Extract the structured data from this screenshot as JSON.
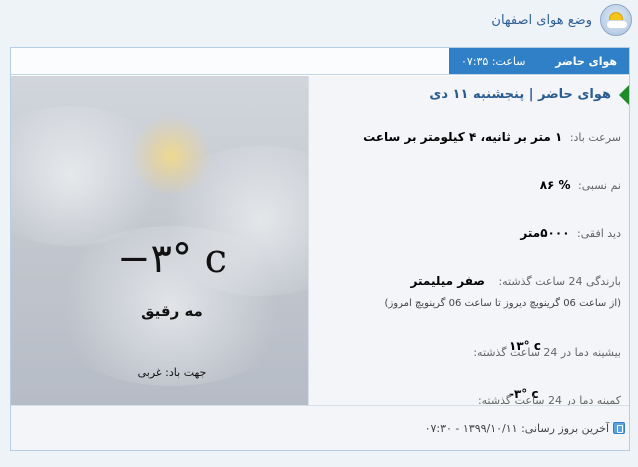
{
  "header": {
    "site_title": "وضع هوای اصفهان",
    "logo_icon": "sun-cloud-icon"
  },
  "tab": {
    "label": "هوای حاضر",
    "time": "ساعت: ۰۷:۳۵"
  },
  "details": {
    "title": "هوای حاضر | پنجشنبه ۱۱ دی",
    "wind_label": "سرعت باد:",
    "wind_value": "۱ متر بر ثانیه، ۴ کیلومتر بر ساعت",
    "humidity_label": "نم نسبی:",
    "humidity_value": "% ۸۶",
    "visibility_label": "دید افقی:",
    "visibility_value": "۵۰۰۰متر",
    "rain_label": "بارندگی 24 ساعت گذشته:",
    "rain_value": "صفر میلیمتر",
    "rain_note": "(از ساعت 06 گرینویچ دیروز تا ساعت 06 گرینویچ امروز)",
    "max_label": "بیشینه دما در 24 ساعت گذشته:",
    "max_value": "۱۳° c",
    "min_label": "کمینه دما در 24 ساعت گذشته:",
    "min_value": "-۳° c"
  },
  "current": {
    "temperature": "−۳° c",
    "condition": "مه رقیق",
    "wind_direction": "جهت باد: غربی"
  },
  "footer": {
    "last_update": "آخرین بروز رسانی: ۱۳۹۹/۱۰/۱۱ - ۰۷:۳۰"
  },
  "colors": {
    "accent": "#2f80c6",
    "title": "#2b5c90",
    "arrow": "#1f8b2a"
  }
}
